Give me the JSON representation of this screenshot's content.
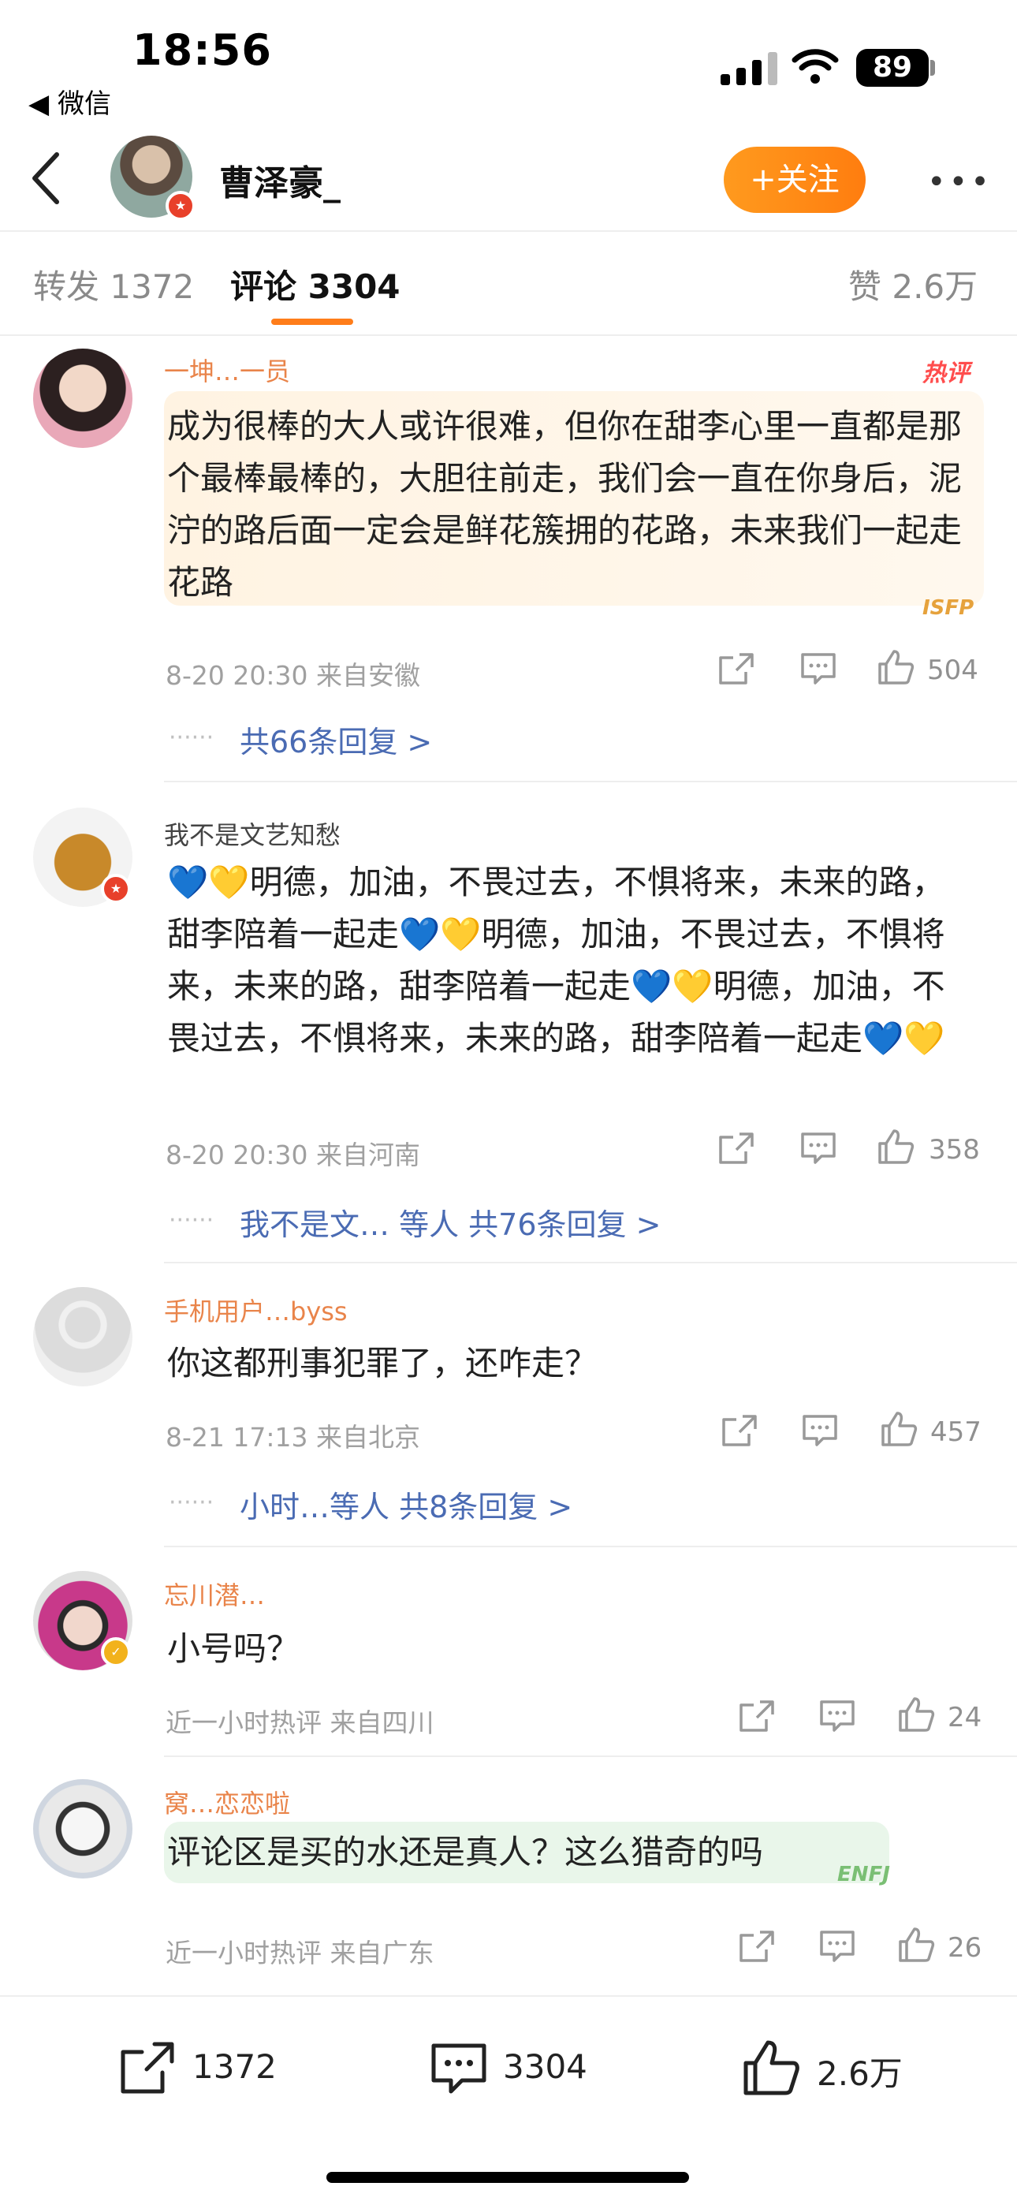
{
  "status": {
    "time": "18:56",
    "back_app": "◀ 微信",
    "battery": "89"
  },
  "header": {
    "username": "曹泽豪_",
    "follow": "+关注",
    "more": "•••"
  },
  "tabs": {
    "repost": "转发 1372",
    "comment": "评论 3304",
    "like": "赞 2.6万"
  },
  "comments": [
    {
      "name": "一坤…一员",
      "hot": "热评",
      "text": "成为很棒的大人或许很难，但你在甜李心里一直都是那个最棒最棒的，大胆往前走，我们会一直在你身后，泥泞的路后面一定会是鲜花簇拥的花路，未来我们一起走花路",
      "sticker": "ISFP",
      "meta": "8-20 20:30  来自安徽",
      "likes": "504",
      "reply": "共66条回复 >"
    },
    {
      "name": "我不是文艺知愁",
      "text": "💙💛明德，加油，不畏过去，不惧将来，未来的路，甜李陪着一起走💙💛明德，加油，不畏过去，不惧将来，未来的路，甜李陪着一起走💙💛明德，加油，不畏过去，不惧将来，未来的路，甜李陪着一起走💙💛",
      "meta": "8-20 20:30  来自河南",
      "likes": "358",
      "reply": "我不是文… 等人  共76条回复 >"
    },
    {
      "name": "手机用户…byss",
      "text": "你这都刑事犯罪了，还咋走？",
      "meta": "8-21 17:13  来自北京",
      "likes": "457",
      "reply": "小时…等人  共8条回复 >"
    },
    {
      "name": "忘川潜…",
      "text": "小号吗？",
      "meta": "近一小时热评  来自四川",
      "likes": "24"
    },
    {
      "name": "窝…恋恋啦",
      "text": "评论区是买的水还是真人？这么猎奇的吗",
      "sticker": "ENFJ",
      "meta": "近一小时热评  来自广东",
      "likes": "26"
    }
  ],
  "bottom": {
    "repost": "1372",
    "comment": "3304",
    "like": "2.6万"
  },
  "colors": {
    "accent": "#ff7d1a",
    "link": "#4a6bb3",
    "name": "#e9844a"
  }
}
